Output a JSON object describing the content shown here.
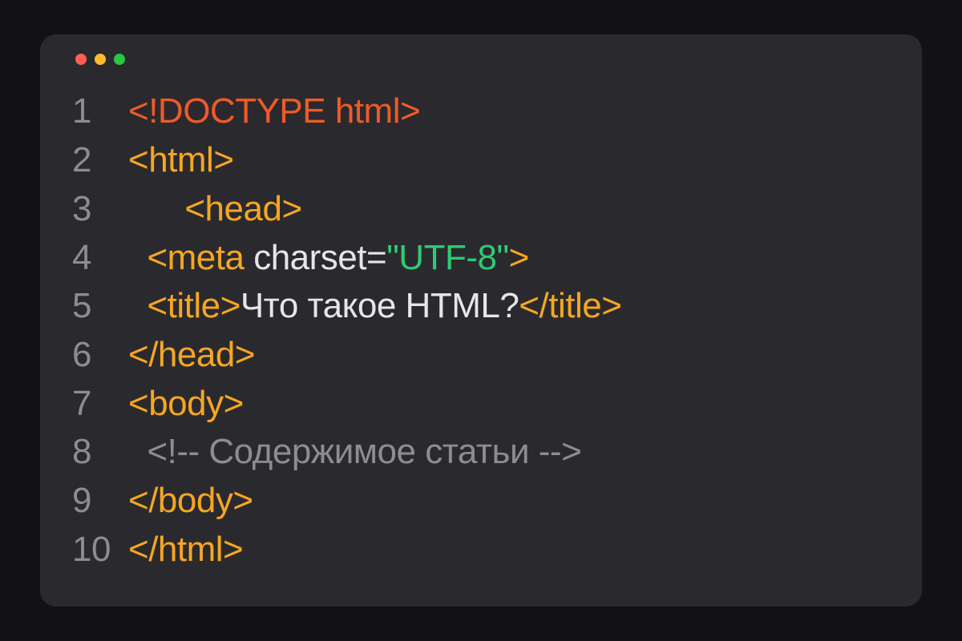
{
  "window": {
    "traffic": {
      "red": "#ff5f57",
      "yellow": "#febc2e",
      "green": "#28c840"
    }
  },
  "colors": {
    "bg_outer": "#121214",
    "bg_window": "#2a2a2e",
    "gutter": "#8c8c92",
    "doctype": "#f05a28",
    "tag": "#f5a623",
    "attr": "#e6e6e6",
    "string": "#2ecc71",
    "text": "#e6e6e6",
    "comment": "#8c8c92"
  },
  "code": {
    "lines": [
      {
        "n": "1",
        "indent": "",
        "tokens": [
          {
            "t": "<!DOCTYPE html>",
            "c": "doctype"
          }
        ]
      },
      {
        "n": "2",
        "indent": "",
        "tokens": [
          {
            "t": "<html>",
            "c": "tag"
          }
        ]
      },
      {
        "n": "3",
        "indent": "      ",
        "tokens": [
          {
            "t": "<head>",
            "c": "tag"
          }
        ]
      },
      {
        "n": "4",
        "indent": "  ",
        "tokens": [
          {
            "t": "<meta",
            "c": "tag"
          },
          {
            "t": " charset=",
            "c": "attr"
          },
          {
            "t": "\"UTF-8\"",
            "c": "string"
          },
          {
            "t": ">",
            "c": "tag"
          }
        ]
      },
      {
        "n": "5",
        "indent": "  ",
        "tokens": [
          {
            "t": "<title>",
            "c": "tag"
          },
          {
            "t": "Что такое HTML?",
            "c": "text"
          },
          {
            "t": "</title>",
            "c": "tag"
          }
        ]
      },
      {
        "n": "6",
        "indent": "",
        "tokens": [
          {
            "t": "</head>",
            "c": "tag"
          }
        ]
      },
      {
        "n": "7",
        "indent": "",
        "tokens": [
          {
            "t": "<body>",
            "c": "tag"
          }
        ]
      },
      {
        "n": "8",
        "indent": "  ",
        "tokens": [
          {
            "t": "<!-- Содержимое статьи -->",
            "c": "comment"
          }
        ]
      },
      {
        "n": "9",
        "indent": "",
        "tokens": [
          {
            "t": "</body>",
            "c": "tag"
          }
        ]
      },
      {
        "n": "10",
        "indent": "",
        "tokens": [
          {
            "t": "</html>",
            "c": "tag"
          }
        ]
      }
    ]
  }
}
